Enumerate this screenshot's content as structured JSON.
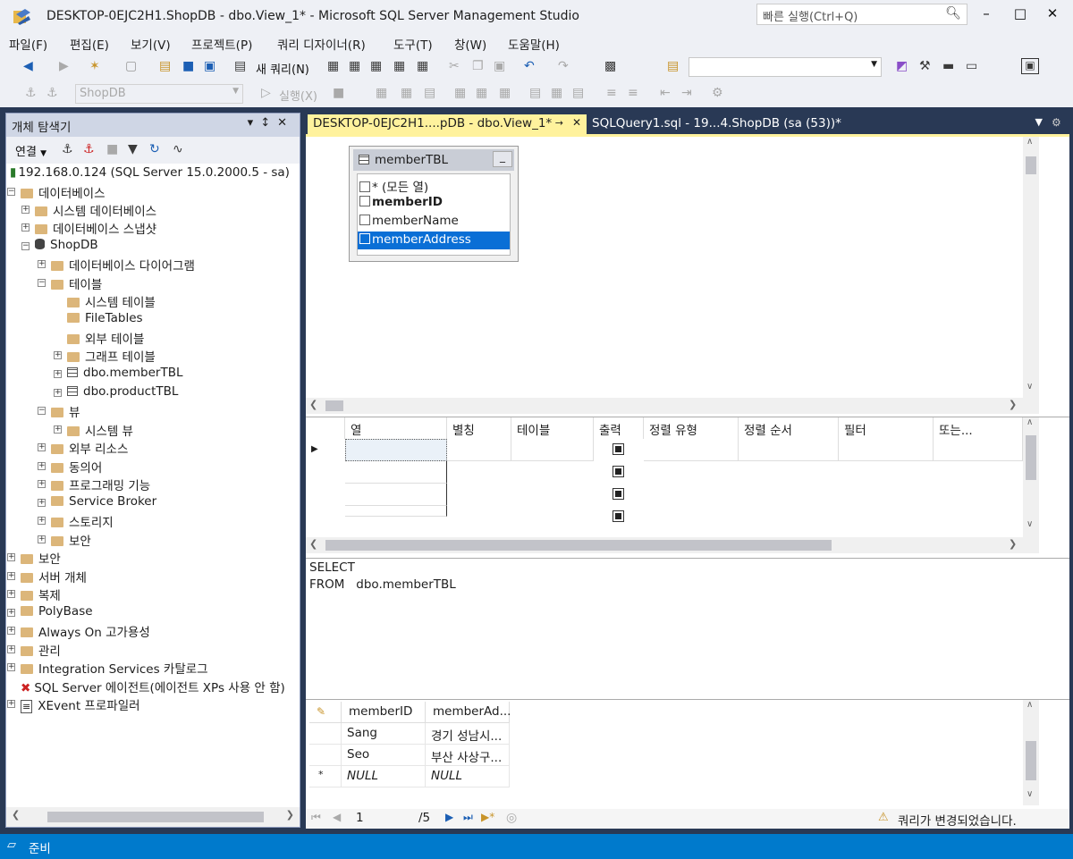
{
  "window": {
    "title": "DESKTOP-0EJC2H1.ShopDB - dbo.View_1* - Microsoft SQL Server Management Studio",
    "quick_launch_placeholder": "빠른 실행(Ctrl+Q)"
  },
  "menu": [
    "파일(F)",
    "편집(E)",
    "보기(V)",
    "프로젝트(P)",
    "쿼리 디자이너(R)",
    "도구(T)",
    "창(W)",
    "도움말(H)"
  ],
  "toolbar": {
    "new_query_label": "새 쿼리(N)",
    "database_combo": "ShopDB",
    "execute_label": "실행(X)"
  },
  "object_explorer": {
    "title": "개체 탐색기",
    "connect_label": "연결",
    "tree": [
      {
        "label": "192.168.0.124 (SQL Server 15.0.2000.5 - sa)"
      },
      {
        "label": "데이터베이스"
      },
      {
        "label": "시스템 데이터베이스"
      },
      {
        "label": "데이터베이스 스냅샷"
      },
      {
        "label": "ShopDB"
      },
      {
        "label": "데이터베이스 다이어그램"
      },
      {
        "label": "테이블"
      },
      {
        "label": "시스템 테이블"
      },
      {
        "label": "FileTables"
      },
      {
        "label": "외부 테이블"
      },
      {
        "label": "그래프 테이블"
      },
      {
        "label": "dbo.memberTBL"
      },
      {
        "label": "dbo.productTBL"
      },
      {
        "label": "뷰"
      },
      {
        "label": "시스템 뷰"
      },
      {
        "label": "외부 리소스"
      },
      {
        "label": "동의어"
      },
      {
        "label": "프로그래밍 기능"
      },
      {
        "label": "Service Broker"
      },
      {
        "label": "스토리지"
      },
      {
        "label": "보안"
      },
      {
        "label": "보안"
      },
      {
        "label": "서버 개체"
      },
      {
        "label": "복제"
      },
      {
        "label": "PolyBase"
      },
      {
        "label": "Always On 고가용성"
      },
      {
        "label": "관리"
      },
      {
        "label": "Integration Services 카탈로그"
      },
      {
        "label": "SQL Server 에이전트(에이전트 XPs 사용 안 함)"
      },
      {
        "label": "XEvent 프로파일러"
      }
    ]
  },
  "tabs": [
    {
      "label": "DESKTOP-0EJC2H1....pDB - dbo.View_1*",
      "active": true
    },
    {
      "label": "SQLQuery1.sql - 19...4.ShopDB (sa (53))*",
      "active": false
    }
  ],
  "diagram": {
    "table_name": "memberTBL",
    "columns": [
      {
        "label": "* (모든 열)",
        "bold": false,
        "selected": false
      },
      {
        "label": "memberID",
        "bold": true,
        "selected": false
      },
      {
        "label": "memberName",
        "bold": false,
        "selected": false
      },
      {
        "label": "memberAddress",
        "bold": false,
        "selected": true
      }
    ]
  },
  "criteria_grid": {
    "headers": [
      "열",
      "별칭",
      "테이블",
      "출력",
      "정렬 유형",
      "정렬 순서",
      "필터",
      "또는..."
    ]
  },
  "sql_pane": {
    "line1": "SELECT",
    "line2_keyword": "FROM",
    "line2_value": "dbo.memberTBL"
  },
  "results": {
    "headers": [
      "memberID",
      "memberAd..."
    ],
    "rows": [
      [
        "Sang",
        "경기 성남시..."
      ],
      [
        "Seo",
        "부산 사상구..."
      ],
      [
        "NULL",
        "NULL"
      ]
    ],
    "nav_current": "1",
    "nav_total": "/5",
    "status_message": "쿼리가 변경되었습니다."
  },
  "statusbar": {
    "text": "준비"
  },
  "colors": {
    "accent": "#007acc",
    "active_tab": "#fff29d",
    "selection": "#0a6fd6"
  }
}
